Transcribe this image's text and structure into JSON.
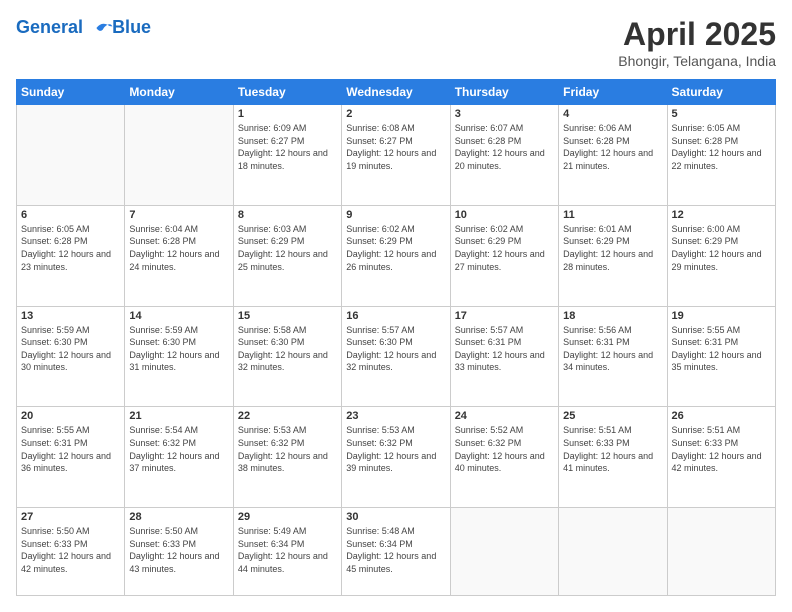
{
  "header": {
    "logo_line1": "General",
    "logo_line2": "Blue",
    "month_title": "April 2025",
    "subtitle": "Bhongir, Telangana, India"
  },
  "days_of_week": [
    "Sunday",
    "Monday",
    "Tuesday",
    "Wednesday",
    "Thursday",
    "Friday",
    "Saturday"
  ],
  "weeks": [
    [
      {
        "day": "",
        "info": ""
      },
      {
        "day": "",
        "info": ""
      },
      {
        "day": "1",
        "sunrise": "6:09 AM",
        "sunset": "6:27 PM",
        "daylight": "12 hours and 18 minutes."
      },
      {
        "day": "2",
        "sunrise": "6:08 AM",
        "sunset": "6:27 PM",
        "daylight": "12 hours and 19 minutes."
      },
      {
        "day": "3",
        "sunrise": "6:07 AM",
        "sunset": "6:28 PM",
        "daylight": "12 hours and 20 minutes."
      },
      {
        "day": "4",
        "sunrise": "6:06 AM",
        "sunset": "6:28 PM",
        "daylight": "12 hours and 21 minutes."
      },
      {
        "day": "5",
        "sunrise": "6:05 AM",
        "sunset": "6:28 PM",
        "daylight": "12 hours and 22 minutes."
      }
    ],
    [
      {
        "day": "6",
        "sunrise": "6:05 AM",
        "sunset": "6:28 PM",
        "daylight": "12 hours and 23 minutes."
      },
      {
        "day": "7",
        "sunrise": "6:04 AM",
        "sunset": "6:28 PM",
        "daylight": "12 hours and 24 minutes."
      },
      {
        "day": "8",
        "sunrise": "6:03 AM",
        "sunset": "6:29 PM",
        "daylight": "12 hours and 25 minutes."
      },
      {
        "day": "9",
        "sunrise": "6:02 AM",
        "sunset": "6:29 PM",
        "daylight": "12 hours and 26 minutes."
      },
      {
        "day": "10",
        "sunrise": "6:02 AM",
        "sunset": "6:29 PM",
        "daylight": "12 hours and 27 minutes."
      },
      {
        "day": "11",
        "sunrise": "6:01 AM",
        "sunset": "6:29 PM",
        "daylight": "12 hours and 28 minutes."
      },
      {
        "day": "12",
        "sunrise": "6:00 AM",
        "sunset": "6:29 PM",
        "daylight": "12 hours and 29 minutes."
      }
    ],
    [
      {
        "day": "13",
        "sunrise": "5:59 AM",
        "sunset": "6:30 PM",
        "daylight": "12 hours and 30 minutes."
      },
      {
        "day": "14",
        "sunrise": "5:59 AM",
        "sunset": "6:30 PM",
        "daylight": "12 hours and 31 minutes."
      },
      {
        "day": "15",
        "sunrise": "5:58 AM",
        "sunset": "6:30 PM",
        "daylight": "12 hours and 32 minutes."
      },
      {
        "day": "16",
        "sunrise": "5:57 AM",
        "sunset": "6:30 PM",
        "daylight": "12 hours and 32 minutes."
      },
      {
        "day": "17",
        "sunrise": "5:57 AM",
        "sunset": "6:31 PM",
        "daylight": "12 hours and 33 minutes."
      },
      {
        "day": "18",
        "sunrise": "5:56 AM",
        "sunset": "6:31 PM",
        "daylight": "12 hours and 34 minutes."
      },
      {
        "day": "19",
        "sunrise": "5:55 AM",
        "sunset": "6:31 PM",
        "daylight": "12 hours and 35 minutes."
      }
    ],
    [
      {
        "day": "20",
        "sunrise": "5:55 AM",
        "sunset": "6:31 PM",
        "daylight": "12 hours and 36 minutes."
      },
      {
        "day": "21",
        "sunrise": "5:54 AM",
        "sunset": "6:32 PM",
        "daylight": "12 hours and 37 minutes."
      },
      {
        "day": "22",
        "sunrise": "5:53 AM",
        "sunset": "6:32 PM",
        "daylight": "12 hours and 38 minutes."
      },
      {
        "day": "23",
        "sunrise": "5:53 AM",
        "sunset": "6:32 PM",
        "daylight": "12 hours and 39 minutes."
      },
      {
        "day": "24",
        "sunrise": "5:52 AM",
        "sunset": "6:32 PM",
        "daylight": "12 hours and 40 minutes."
      },
      {
        "day": "25",
        "sunrise": "5:51 AM",
        "sunset": "6:33 PM",
        "daylight": "12 hours and 41 minutes."
      },
      {
        "day": "26",
        "sunrise": "5:51 AM",
        "sunset": "6:33 PM",
        "daylight": "12 hours and 42 minutes."
      }
    ],
    [
      {
        "day": "27",
        "sunrise": "5:50 AM",
        "sunset": "6:33 PM",
        "daylight": "12 hours and 42 minutes."
      },
      {
        "day": "28",
        "sunrise": "5:50 AM",
        "sunset": "6:33 PM",
        "daylight": "12 hours and 43 minutes."
      },
      {
        "day": "29",
        "sunrise": "5:49 AM",
        "sunset": "6:34 PM",
        "daylight": "12 hours and 44 minutes."
      },
      {
        "day": "30",
        "sunrise": "5:48 AM",
        "sunset": "6:34 PM",
        "daylight": "12 hours and 45 minutes."
      },
      {
        "day": "",
        "info": ""
      },
      {
        "day": "",
        "info": ""
      },
      {
        "day": "",
        "info": ""
      }
    ]
  ],
  "labels": {
    "sunrise_prefix": "Sunrise: ",
    "sunset_prefix": "Sunset: ",
    "daylight_prefix": "Daylight: "
  }
}
